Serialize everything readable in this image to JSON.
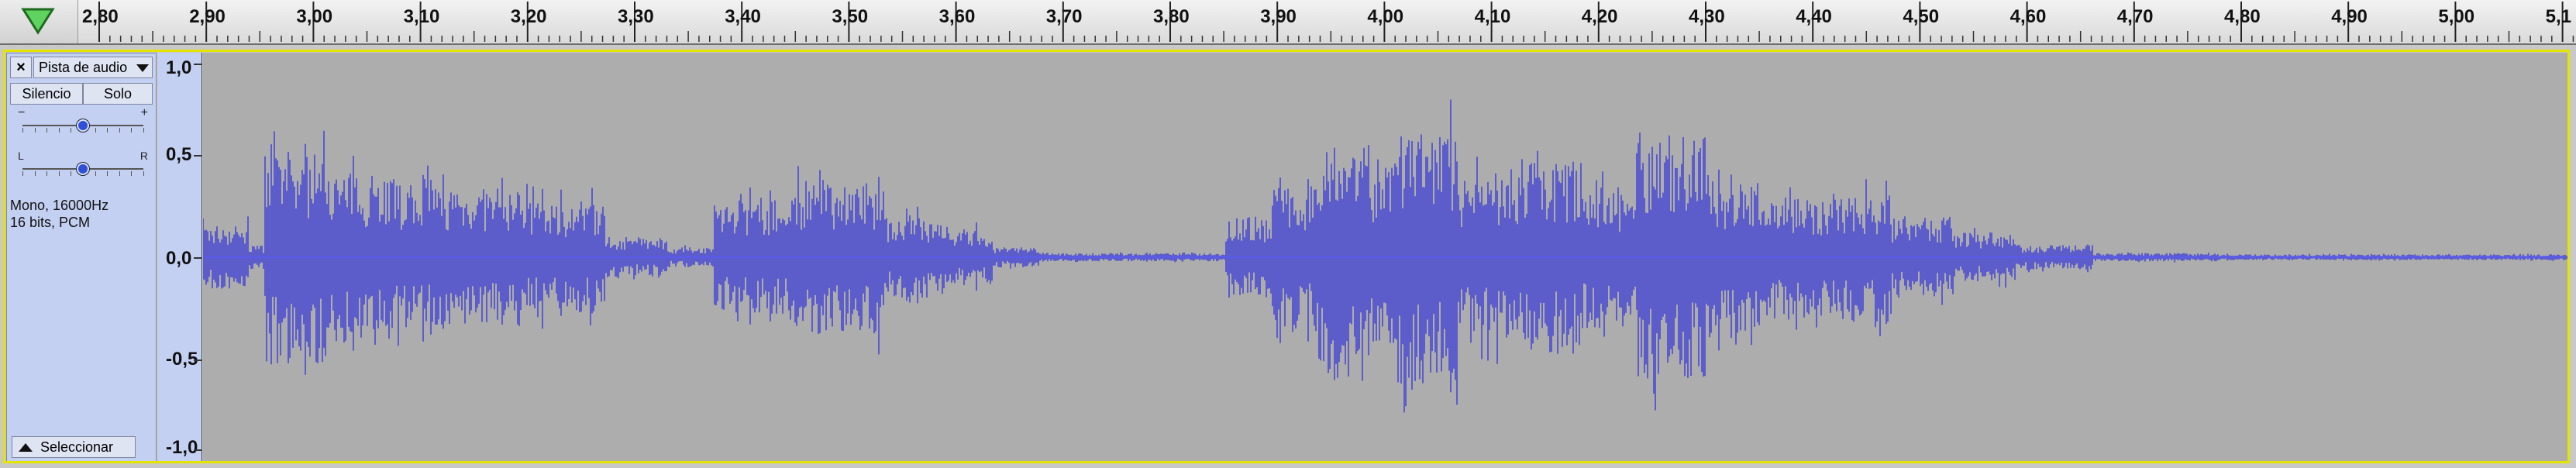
{
  "ruler": {
    "ticks": [
      "2,80",
      "2,90",
      "3,00",
      "3,10",
      "3,20",
      "3,30",
      "3,40",
      "3,50",
      "3,60",
      "3,70",
      "3,80",
      "3,90",
      "4,00",
      "4,10",
      "4,20",
      "4,30",
      "4,40",
      "4,50",
      "4,60",
      "4,70",
      "4,80",
      "4,90",
      "5,00",
      "5,1"
    ],
    "play_icon": "play-triangle-icon"
  },
  "track": {
    "close_label": "×",
    "name": "Pista de audio",
    "mute_label": "Silencio",
    "solo_label": "Solo",
    "gain_minus": "−",
    "gain_plus": "+",
    "pan_left": "L",
    "pan_right": "R",
    "format_line1": "Mono, 16000Hz",
    "format_line2": "16 bits, PCM",
    "select_label": "Seleccionar",
    "gain_value": 0.5,
    "pan_value": 0.5
  },
  "scale": {
    "labels": [
      "1,0",
      "0,5",
      "0,0",
      "-0,5",
      "-1,0"
    ]
  },
  "colors": {
    "waveform": "#3a3ad6",
    "waveform_center": "#5a5af0",
    "background": "#adadad",
    "selection_outline": "#e4e400"
  }
}
